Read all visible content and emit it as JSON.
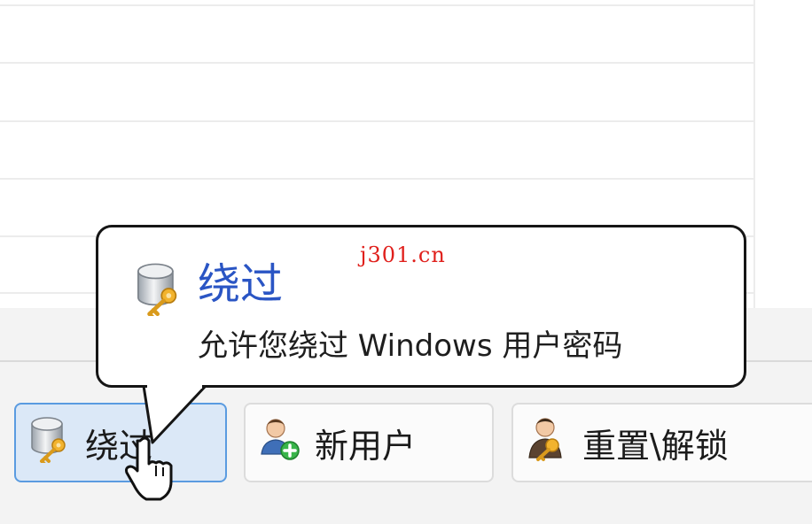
{
  "toolbar": {
    "buttons": [
      {
        "label": "绕过",
        "icon": "database-key-icon",
        "active": true
      },
      {
        "label": "新用户",
        "icon": "add-user-icon",
        "active": false
      },
      {
        "label": "重置\\解锁",
        "icon": "user-key-icon",
        "active": false
      }
    ]
  },
  "tooltip": {
    "title": "绕过",
    "description": "允许您绕过 Windows 用户密码",
    "icon": "database-key-icon"
  },
  "watermark": "j301.cn",
  "colors": {
    "accent": "#2a55c4",
    "active_button_bg": "#dbe8f7",
    "active_button_border": "#5a9be0",
    "watermark": "#e0201c"
  }
}
